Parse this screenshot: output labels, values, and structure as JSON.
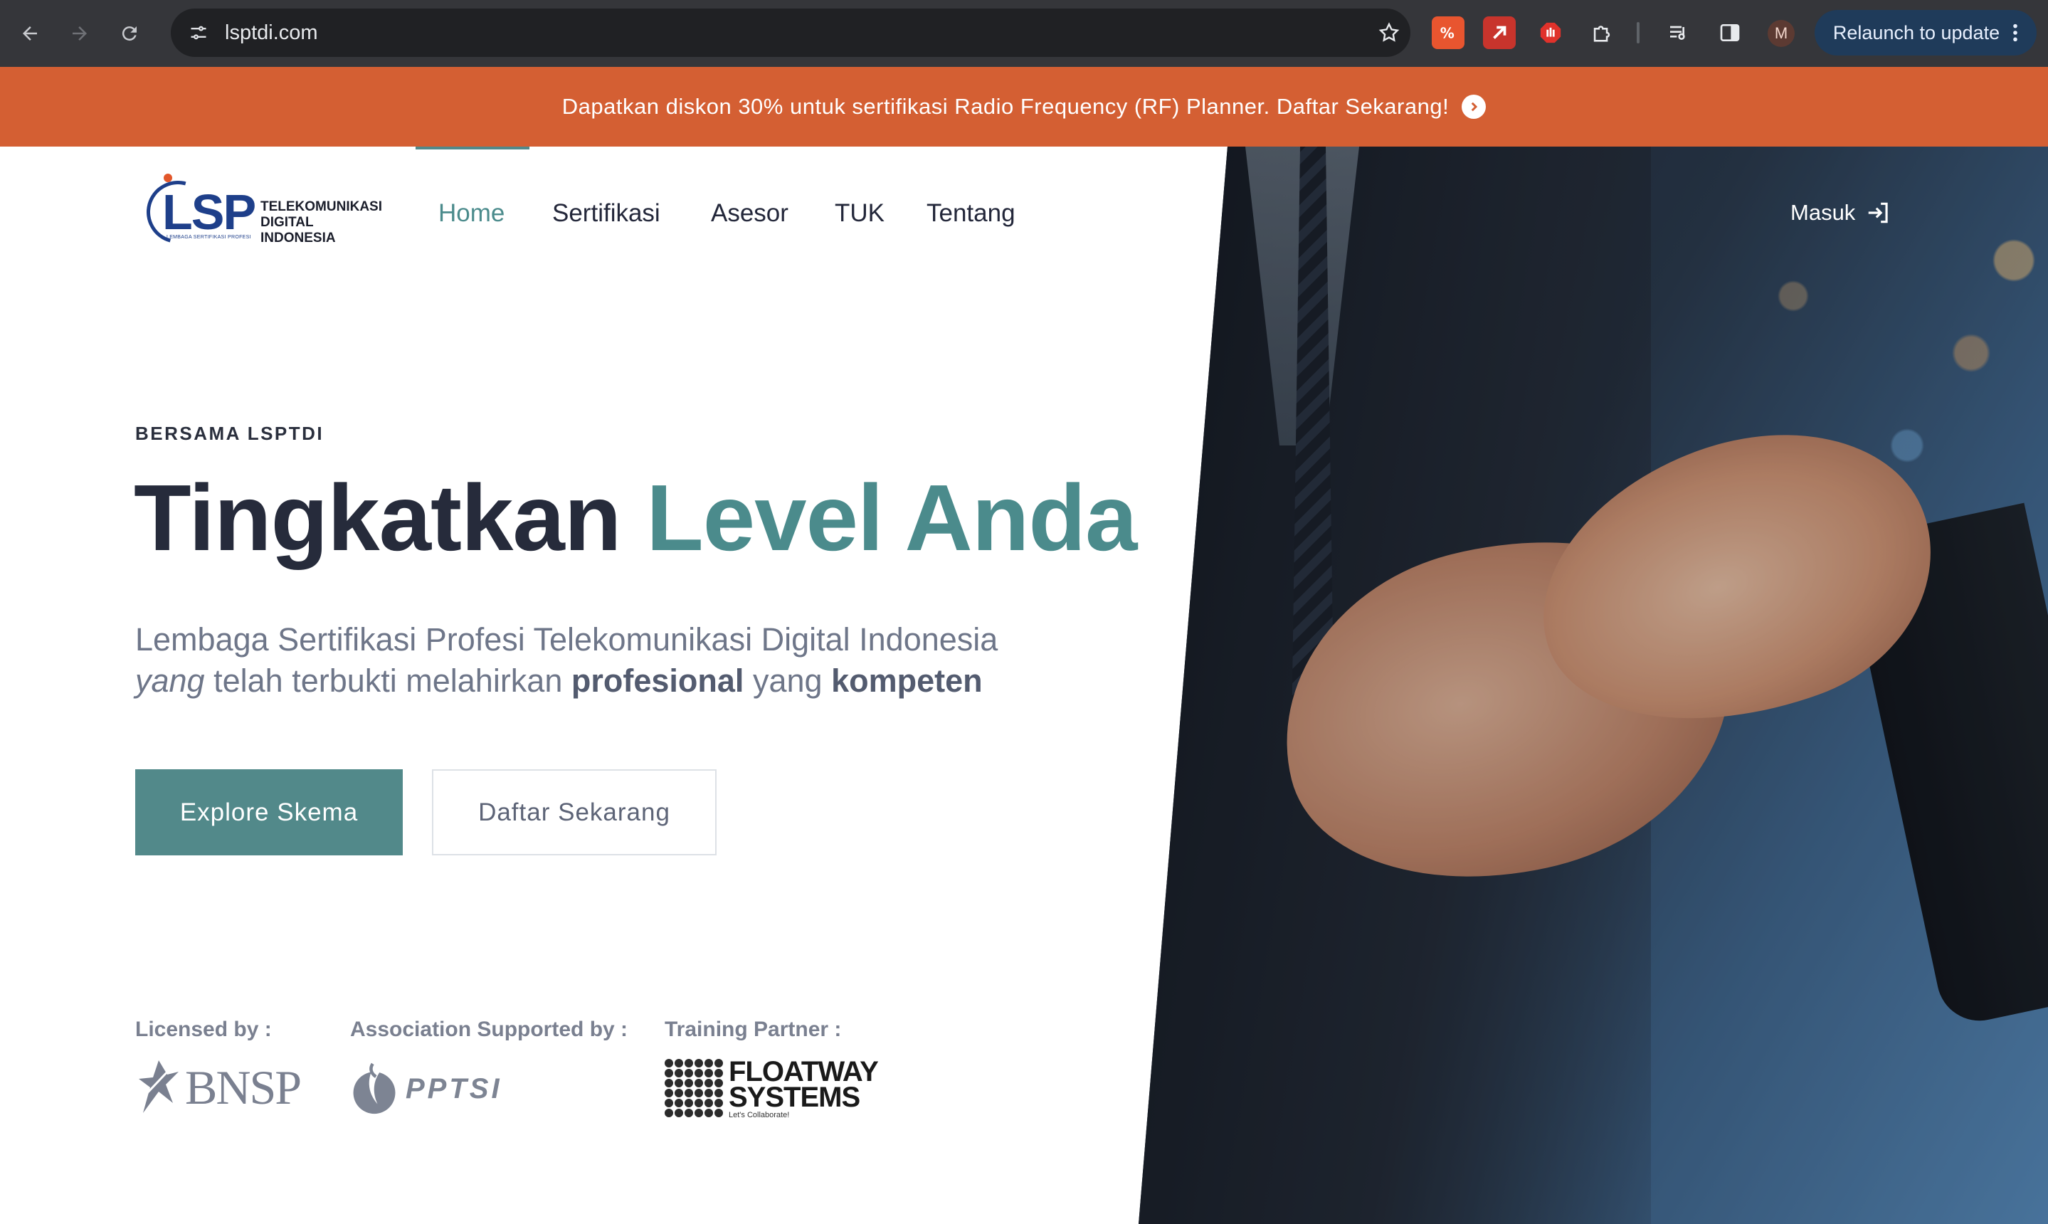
{
  "browser": {
    "url": "lsptdi.com",
    "relaunch_label": "Relaunch to update",
    "profile_initial": "M"
  },
  "banner": {
    "text": "Dapatkan diskon 30% untuk sertifikasi Radio Frequency (RF) Planner. Daftar Sekarang!"
  },
  "logo": {
    "mark": "LSP",
    "line1": "TELEKOMUNIKASI",
    "line2": "DIGITAL",
    "line3": "INDONESIA",
    "tagline": "LEMBAGA SERTIFIKASI PROFESI"
  },
  "nav": {
    "items": [
      "Home",
      "Sertifikasi",
      "Asesor",
      "TUK",
      "Tentang"
    ],
    "active": "Home",
    "login": "Masuk"
  },
  "hero": {
    "eyebrow": "BERSAMA LSPTDI",
    "headline_plain": "Tingkatkan",
    "headline_accent": "Level Anda",
    "subtitle_line1": "Lembaga Sertifikasi Profesi Telekomunikasi Digital Indonesia",
    "subtitle_italic": "yang",
    "subtitle_mid": "telah terbukti melahirkan",
    "subtitle_bold1": "profesional",
    "subtitle_join": "yang",
    "subtitle_bold2": "kompeten",
    "primary_button": "Explore Skema",
    "secondary_button": "Daftar Sekarang"
  },
  "partners": {
    "licensed_label": "Licensed by :",
    "licensed_logo": "BNSP",
    "association_label": "Association Supported by :",
    "association_logo": "PPTSI",
    "training_label": "Training Partner :",
    "training_logo_line1": "FLOATWAY",
    "training_logo_line2": "SYSTEMS",
    "training_logo_tagline": "Let's Collaborate!"
  },
  "colors": {
    "accent": "#52898a",
    "banner": "#d45f33",
    "heading": "#262b3b",
    "chrome": "#35363a"
  }
}
